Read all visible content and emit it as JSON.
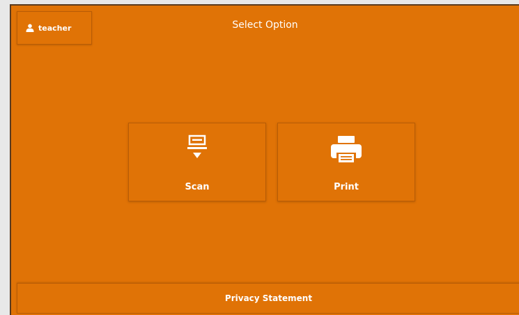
{
  "header": {
    "user": {
      "icon": "user-icon",
      "label": "teacher"
    },
    "title": "Select Option"
  },
  "options": [
    {
      "icon": "scan-icon",
      "label": "Scan"
    },
    {
      "icon": "printer-icon",
      "label": "Print"
    }
  ],
  "footer": {
    "label": "Privacy Statement"
  },
  "colors": {
    "background": "#e07306",
    "border": "#b85c06",
    "text": "#ffffff"
  }
}
